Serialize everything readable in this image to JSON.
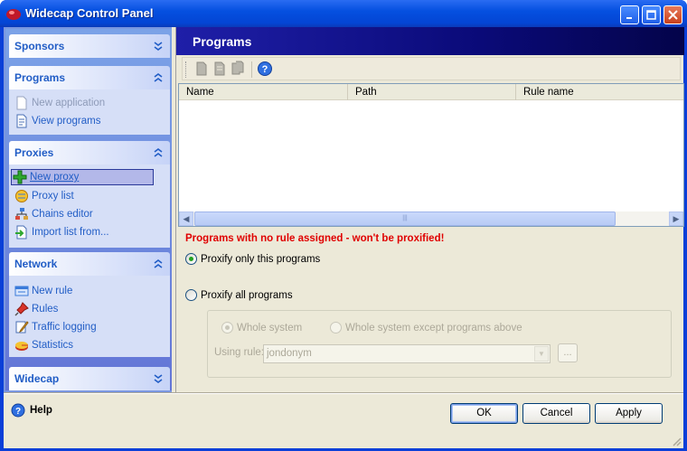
{
  "window": {
    "title": "Widecap Control Panel"
  },
  "sidebar": {
    "groups": {
      "sponsors": {
        "title": "Sponsors"
      },
      "programs": {
        "title": "Programs",
        "items": [
          "New application",
          "View programs"
        ]
      },
      "proxies": {
        "title": "Proxies",
        "items": [
          "New proxy",
          "Proxy list",
          "Chains editor",
          "Import list from..."
        ]
      },
      "network": {
        "title": "Network",
        "items": [
          "New rule",
          "Rules",
          "Traffic logging",
          "Statistics"
        ]
      },
      "widecap": {
        "title": "Widecap"
      }
    }
  },
  "main": {
    "header": "Programs",
    "columns": [
      "Name",
      "Path",
      "Rule name"
    ],
    "warning": "Programs with no rule assigned - won't be proxified!",
    "options": {
      "proxify_only": "Proxify only this programs",
      "proxify_all": "Proxify all programs",
      "whole_system": "Whole system",
      "whole_except": "Whole system except programs above",
      "using_rule_label": "Using rule:",
      "using_rule_value": "jondonym",
      "browse_label": "..."
    }
  },
  "footer": {
    "help": "Help",
    "ok": "OK",
    "cancel": "Cancel",
    "apply": "Apply"
  },
  "colors": {
    "warning": "#e00000",
    "header_bg": "#0a0a78",
    "titlebar": "#0550e0"
  }
}
